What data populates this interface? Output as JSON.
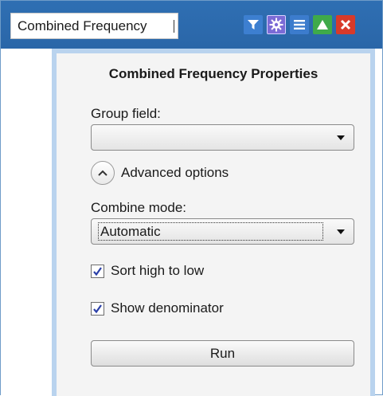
{
  "window": {
    "title_field_value": "Combined Frequency"
  },
  "toolbar": {
    "icons": [
      "filter-icon",
      "gear-icon",
      "menu-icon",
      "maximize-icon",
      "close-icon"
    ],
    "colors": {
      "titlebar": "#2f6fb3",
      "filter": "#3d7fd0",
      "gear": "#7b6bd6",
      "up": "#3faa4a",
      "close": "#d83a2a"
    }
  },
  "panel": {
    "title": "Combined Frequency Properties",
    "group_field_label": "Group field:",
    "group_field_value": "",
    "advanced_label": "Advanced options",
    "combine_mode_label": "Combine mode:",
    "combine_mode_value": "Automatic",
    "sort_label": "Sort high to low",
    "sort_checked": true,
    "denominator_label": "Show denominator",
    "denominator_checked": true,
    "run_label": "Run"
  }
}
